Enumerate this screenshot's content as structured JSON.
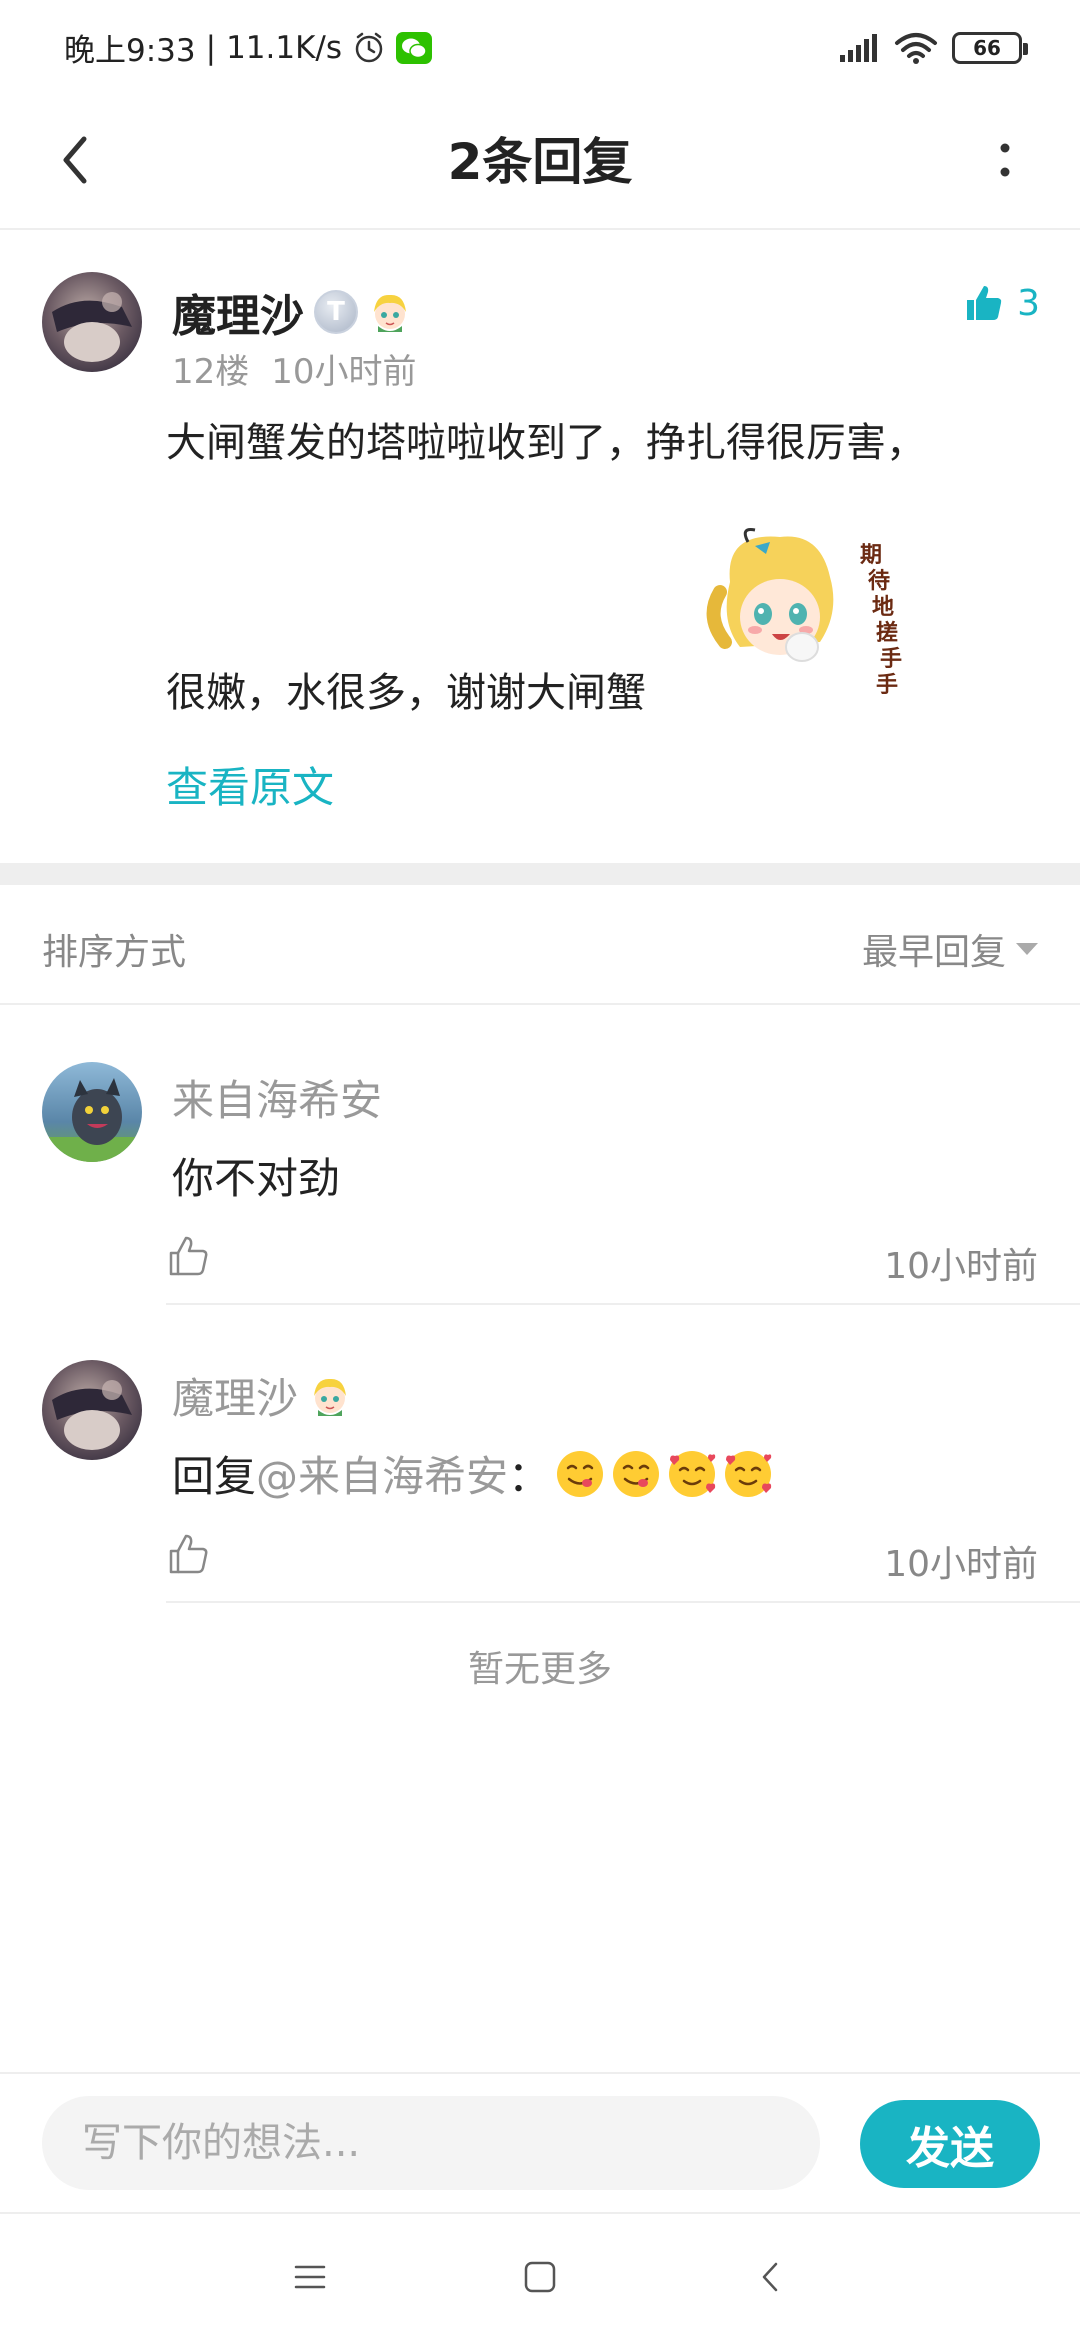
{
  "status_bar": {
    "time": "晚上9:33",
    "speed": "11.1K/s",
    "battery": "66"
  },
  "header": {
    "title": "2条回复"
  },
  "main_post": {
    "username": "魔理沙",
    "badge_letter": "T",
    "likes": "3",
    "floor": "12楼",
    "time": "10小时前",
    "text_line_1": "大闸蟹发的塔啦啦收到了，挣扎得很厉害，",
    "text_line_2": "很嫩，水很多，谢谢大闸蟹",
    "sticker_text": "期待地搓手手",
    "view_original": "查看原文"
  },
  "sort": {
    "label": "排序方式",
    "selected": "最早回复"
  },
  "replies": [
    {
      "username": "来自海希安",
      "text": "你不对劲",
      "time": "10小时前"
    },
    {
      "username": "魔理沙",
      "reply_prefix": "回复",
      "mention": "@来自海希安",
      "colon": "：",
      "time": "10小时前"
    }
  ],
  "footer_text": "暂无更多",
  "input": {
    "placeholder": "写下你的想法..."
  },
  "send_label": "发送",
  "colors": {
    "accent": "#19b4c3",
    "muted": "#999999",
    "divider": "#eeeeee"
  }
}
